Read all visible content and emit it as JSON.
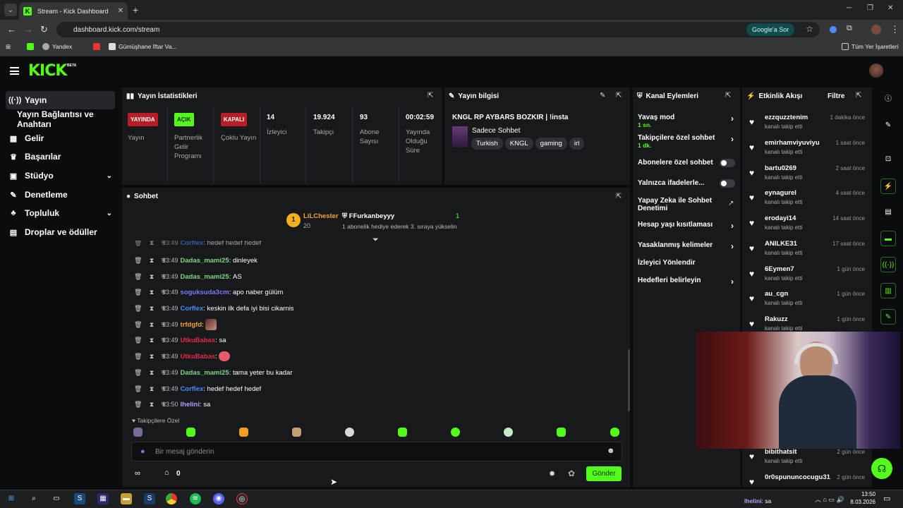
{
  "browser": {
    "tab_title": "Stream - Kick Dashboard",
    "url": "dashboard.kick.com/stream",
    "google_button": "Google'a Sor",
    "bookmarks": [
      "Yandex",
      "Gümüşhane İftar Va..."
    ],
    "all_bookmarks": "Tüm Yer İşaretleri"
  },
  "kick": {
    "logo": "KICK",
    "beta": "BETA"
  },
  "sidebar": {
    "items": [
      {
        "label": "Yayın",
        "icon": "broadcast-icon"
      },
      {
        "label": "Yayın Bağlantısı ve Anahtarı"
      },
      {
        "label": "Gelir",
        "icon": "revenue-icon"
      },
      {
        "label": "Başarılar",
        "icon": "trophy-icon"
      },
      {
        "label": "Stüdyo",
        "icon": "studio-icon"
      },
      {
        "label": "Denetleme",
        "icon": "wrench-icon"
      },
      {
        "label": "Topluluk",
        "icon": "community-icon"
      },
      {
        "label": "Droplar ve ödüller",
        "icon": "gift-icon"
      }
    ]
  },
  "stats": {
    "title": "Yayın İstatistikleri",
    "items": [
      {
        "badge": "YAYINDA",
        "label": "Yayın",
        "color": "#e0242e"
      },
      {
        "badge": "AÇIK",
        "label": "Partnerlik Gelir Programı",
        "color": "#53fc18"
      },
      {
        "badge": "KAPALI",
        "label": "Çoklu Yayın",
        "color": "#e0242e"
      },
      {
        "value": "14",
        "label": "İzleyici"
      },
      {
        "value": "19.924",
        "label": "Takipçi"
      },
      {
        "value": "93",
        "label": "Abone Sayısı"
      },
      {
        "value": "00:02:59",
        "label": "Yayında Olduğu Süre"
      }
    ]
  },
  "stream_info": {
    "title": "Yayın bilgisi",
    "stream_title": "KNGL RP AYBARS BOZKIR | !insta",
    "category": "Sadece Sohbet",
    "tags": [
      "Turkish",
      "KNGL",
      "gaming",
      "irl"
    ]
  },
  "chat": {
    "title": "Sohbet",
    "leader": {
      "rank": "1",
      "name": "LiLChester",
      "count": "20"
    },
    "goal": {
      "name": "FFurkanbeyyy",
      "text": "1 abonelik hediye ederek 3. sıraya yükselin",
      "count": "1"
    },
    "messages": [
      {
        "time": "13:49",
        "user": "Corflex",
        "text": "hedef hedef hedef",
        "color": "#4a8cff"
      },
      {
        "time": "13:49",
        "user": "Dadas_mami25",
        "text": "dinleyek",
        "color": "#7fd67f"
      },
      {
        "time": "13:49",
        "user": "Dadas_mami25",
        "text": "AS",
        "color": "#7fd67f"
      },
      {
        "time": "13:49",
        "user": "soguksuda3cm",
        "text": "apo naber gülüm",
        "color": "#7a7aff"
      },
      {
        "time": "13:49",
        "user": "Corflex",
        "text": "keskin ilk defa iyi bisi cikarnis",
        "color": "#4a8cff"
      },
      {
        "time": "13:49",
        "user": "trfdgfd",
        "text": "",
        "color": "#f7a232"
      },
      {
        "time": "13:49",
        "user": "UtkuBabas",
        "text": "sa",
        "color": "#e8284a"
      },
      {
        "time": "13:49",
        "user": "UtkuBabas",
        "text": "",
        "color": "#e8284a"
      },
      {
        "time": "13:49",
        "user": "Dadas_mami25",
        "text": "tama yeter bu kadar",
        "color": "#7fd67f"
      },
      {
        "time": "13:49",
        "user": "Corflex",
        "text": "hedef hedef hedef",
        "color": "#4a8cff"
      },
      {
        "time": "13:50",
        "user": "Ihelini",
        "text": "sa",
        "color": "#b8a0ff"
      }
    ],
    "followers_only": "Takipçilere Özel",
    "input_placeholder": "Bir mesaj gönderin",
    "points": "0",
    "send": "Gönder"
  },
  "channel_actions": {
    "title": "Kanal Eylemleri",
    "items": [
      {
        "label": "Yavaş mod",
        "sub": "1 sn.",
        "control": "arrow"
      },
      {
        "label": "Takipçilere özel sohbet",
        "sub": "1 dk.",
        "control": "arrow"
      },
      {
        "label": "Abonelere özel sohbet",
        "control": "toggle"
      },
      {
        "label": "Yalnızca ifadelerle...",
        "control": "toggle"
      },
      {
        "label": "Yapay Zeka ile Sohbet Denetimi",
        "control": "external"
      },
      {
        "label": "Hesap yaşı kısıtlaması",
        "control": "arrow"
      },
      {
        "label": "Yasaklanmış kelimeler",
        "control": "arrow"
      },
      {
        "label": "İzleyici Yönlendir",
        "control": "none"
      },
      {
        "label": "Hedefleri belirleyin",
        "control": "arrow"
      }
    ]
  },
  "activity": {
    "title": "Etkinlik Akışı",
    "filter": "Filtre",
    "items": [
      {
        "user": "ezzquzztenim",
        "desc": "kanalı takip etti",
        "time": "1 dakika önce"
      },
      {
        "user": "emirhamviyuviyu",
        "desc": "kanalı takip etti",
        "time": "1 saat önce"
      },
      {
        "user": "bartu0269",
        "desc": "kanalı takip etti",
        "time": "2 saat önce"
      },
      {
        "user": "eynagurel",
        "desc": "kanalı takip etti",
        "time": "4 saat önce"
      },
      {
        "user": "erodayi14",
        "desc": "kanalı takip etti",
        "time": "14 saat önce"
      },
      {
        "user": "ANILKE31",
        "desc": "kanalı takip etti",
        "time": "17 saat önce"
      },
      {
        "user": "6Eymen7",
        "desc": "kanalı takip etti",
        "time": "1 gün önce"
      },
      {
        "user": "au_cgn",
        "desc": "kanalı takip etti",
        "time": "1 gün önce"
      },
      {
        "user": "Rakuzz",
        "desc": "kanalı takip etti",
        "time": "1 gün önce"
      },
      {
        "user": "bibithatsit",
        "desc": "kanalı takip etti",
        "time": "2 gün önce"
      },
      {
        "user": "0r0spununcocugu31",
        "desc": "kanalı takip etti",
        "time": "2 gün önce"
      }
    ]
  },
  "taskbar": {
    "user": "Ihelini",
    "user_text": "sa",
    "time": "13:50",
    "date": "8.03.2026"
  },
  "colors": {
    "accent": "#53fc18",
    "live": "#e0242e",
    "panel": "#18191c"
  }
}
